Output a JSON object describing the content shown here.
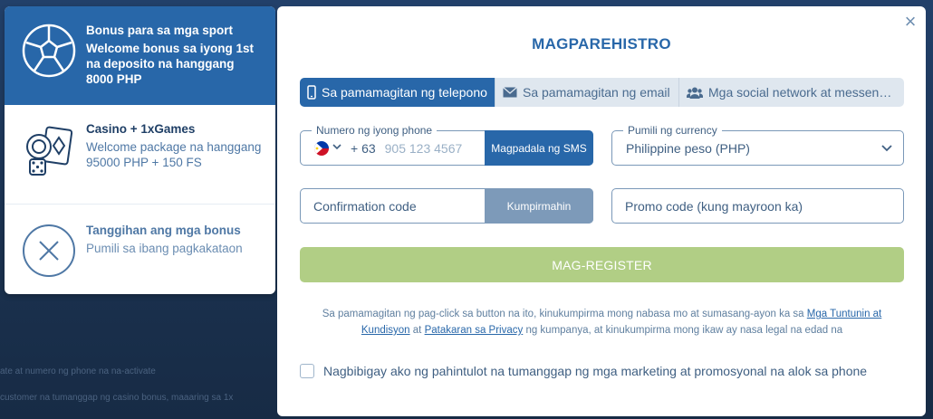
{
  "background": {
    "line1": "ate at numero ng phone na na-activate",
    "line2": "customer na tumanggap ng casino bonus, maaaring sa 1x"
  },
  "bonuses": [
    {
      "title": "Bonus para sa mga sport",
      "desc": "Welcome bonus sa iyong 1st na deposito na hanggang 8000 PHP",
      "icon": "soccer-ball-icon"
    },
    {
      "title": "Casino + 1xGames",
      "desc": "Welcome package na hanggang 95000 PHP + 150 FS",
      "icon": "casino-chips-icon"
    },
    {
      "title": "Tanggihan ang mga bonus",
      "desc": "Pumili sa ibang pagkakataon",
      "icon": "close-circle-icon"
    }
  ],
  "modal": {
    "title": "MAGPAREHISTRO",
    "close_icon": "×",
    "tabs": [
      {
        "label": "Sa pamamagitan ng telepono",
        "icon": "phone-icon"
      },
      {
        "label": "Sa pamamagitan ng email",
        "icon": "envelope-icon"
      },
      {
        "label": "Mga social network at messengers",
        "icon": "users-icon"
      }
    ],
    "phone": {
      "label": "Numero ng iyong phone",
      "prefix": "+ 63",
      "placeholder": "905 123 4567",
      "sms_button": "Magpadala ng SMS"
    },
    "currency": {
      "label": "Pumili ng currency",
      "value": "Philippine peso (PHP)"
    },
    "confirmation": {
      "placeholder": "Confirmation code",
      "button": "Kumpirmahin"
    },
    "promo": {
      "placeholder": "Promo code (kung mayroon ka)"
    },
    "register_button": "MAG-REGISTER",
    "terms": {
      "before": "Sa pamamagitan ng pag-click sa button na ito, kinukumpirma mong nabasa mo at sumasang-ayon ka sa ",
      "link1": "Mga Tuntunin at Kundisyon",
      "middle": " at ",
      "link2": "Patakaran sa Privacy",
      "after": " ng kumpanya, at kinukumpirma mong ikaw ay nasa legal na edad na"
    },
    "marketing_label": "Nagbibigay ako ng pahintulot na tumanggap ng mga marketing at promosyonal na alok sa phone"
  },
  "colors": {
    "primary": "#2867a9",
    "register": "#b1ce85",
    "confirm": "#7d9ab9"
  }
}
